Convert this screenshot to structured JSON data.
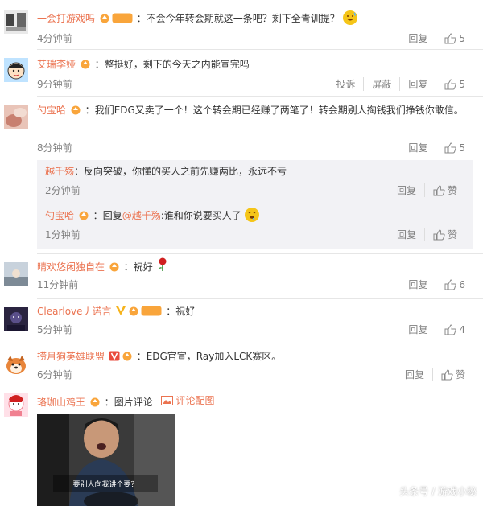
{
  "colors": {
    "username": "#eb7350",
    "meta": "#808080",
    "reply_bg": "#f2f2f5",
    "badge_orange": "#f9a53b",
    "vip_gold": "#f6b31c"
  },
  "comments": [
    {
      "username": "一会打游戏吗",
      "separator": "：",
      "text": "不会今年转会期就这一条吧？剩下全青训提？",
      "emoji": "grinning-sweat-icon",
      "badges": [
        "level-badge-icon",
        "fan-badge-icon"
      ],
      "fan_label": "铁粉",
      "time": "4分钟前",
      "reply": "回复",
      "likes": "5"
    },
    {
      "username": "艾瑞李娅",
      "separator": "：",
      "text": "整挺好，剩下的今天之内能宣完吗",
      "badges": [
        "level-badge-icon"
      ],
      "time": "9分钟前",
      "report": "投诉",
      "block": "屏蔽",
      "reply": "回复",
      "likes": "5"
    },
    {
      "username": "勺宝哈",
      "separator": "：",
      "text": "我们EDG又卖了一个！这个转会期已经赚了两笔了！转会期别人掏钱我们挣钱你敢信。",
      "badges": [
        "level-badge-icon"
      ],
      "time": "8分钟前",
      "reply": "回复",
      "likes": "5",
      "sub_replies": [
        {
          "username": "越千殇",
          "separator": "：",
          "text": "反向突破，你懂的买人之前先赚两比，永远不亏",
          "time": "2分钟前",
          "reply": "回复",
          "like_label": "赞"
        },
        {
          "username": "勺宝哈",
          "separator": "：",
          "reply_prefix": "回复",
          "mention": "@越千殇",
          "text": ":谁和你说要买人了",
          "emoji": "drool-face-icon",
          "time": "1分钟前",
          "reply": "回复",
          "like_label": "赞"
        }
      ]
    },
    {
      "username": "晴欢悠闲独自在",
      "separator": "：",
      "text": "祝好",
      "emoji": "rose-icon",
      "badges": [
        "level-badge-icon"
      ],
      "time": "11分钟前",
      "reply": "回复",
      "likes": "6"
    },
    {
      "username": "Clearlove丿诺言",
      "separator": "：",
      "text": "祝好",
      "badges": [
        "vip-badge-icon",
        "level-badge-icon",
        "fan-badge-icon"
      ],
      "fan_label": "铁粉",
      "time": "5分钟前",
      "reply": "回复",
      "likes": "4"
    },
    {
      "username": "捞月狗英雄联盟",
      "separator": "：",
      "text": "EDG官宣，Ray加入LCK赛区。",
      "badges": [
        "v-badge-icon",
        "level-badge-icon"
      ],
      "time": "6分钟前",
      "reply": "回复",
      "like_label": "赞"
    },
    {
      "username": "珞珈山鸡王",
      "separator": "：",
      "text": "图片评论",
      "badges": [
        "level-badge-icon"
      ],
      "image_link": "评论配图",
      "image_caption": "要别人向我讲个要？"
    }
  ],
  "watermark": "头条号 / 游戏小秘"
}
